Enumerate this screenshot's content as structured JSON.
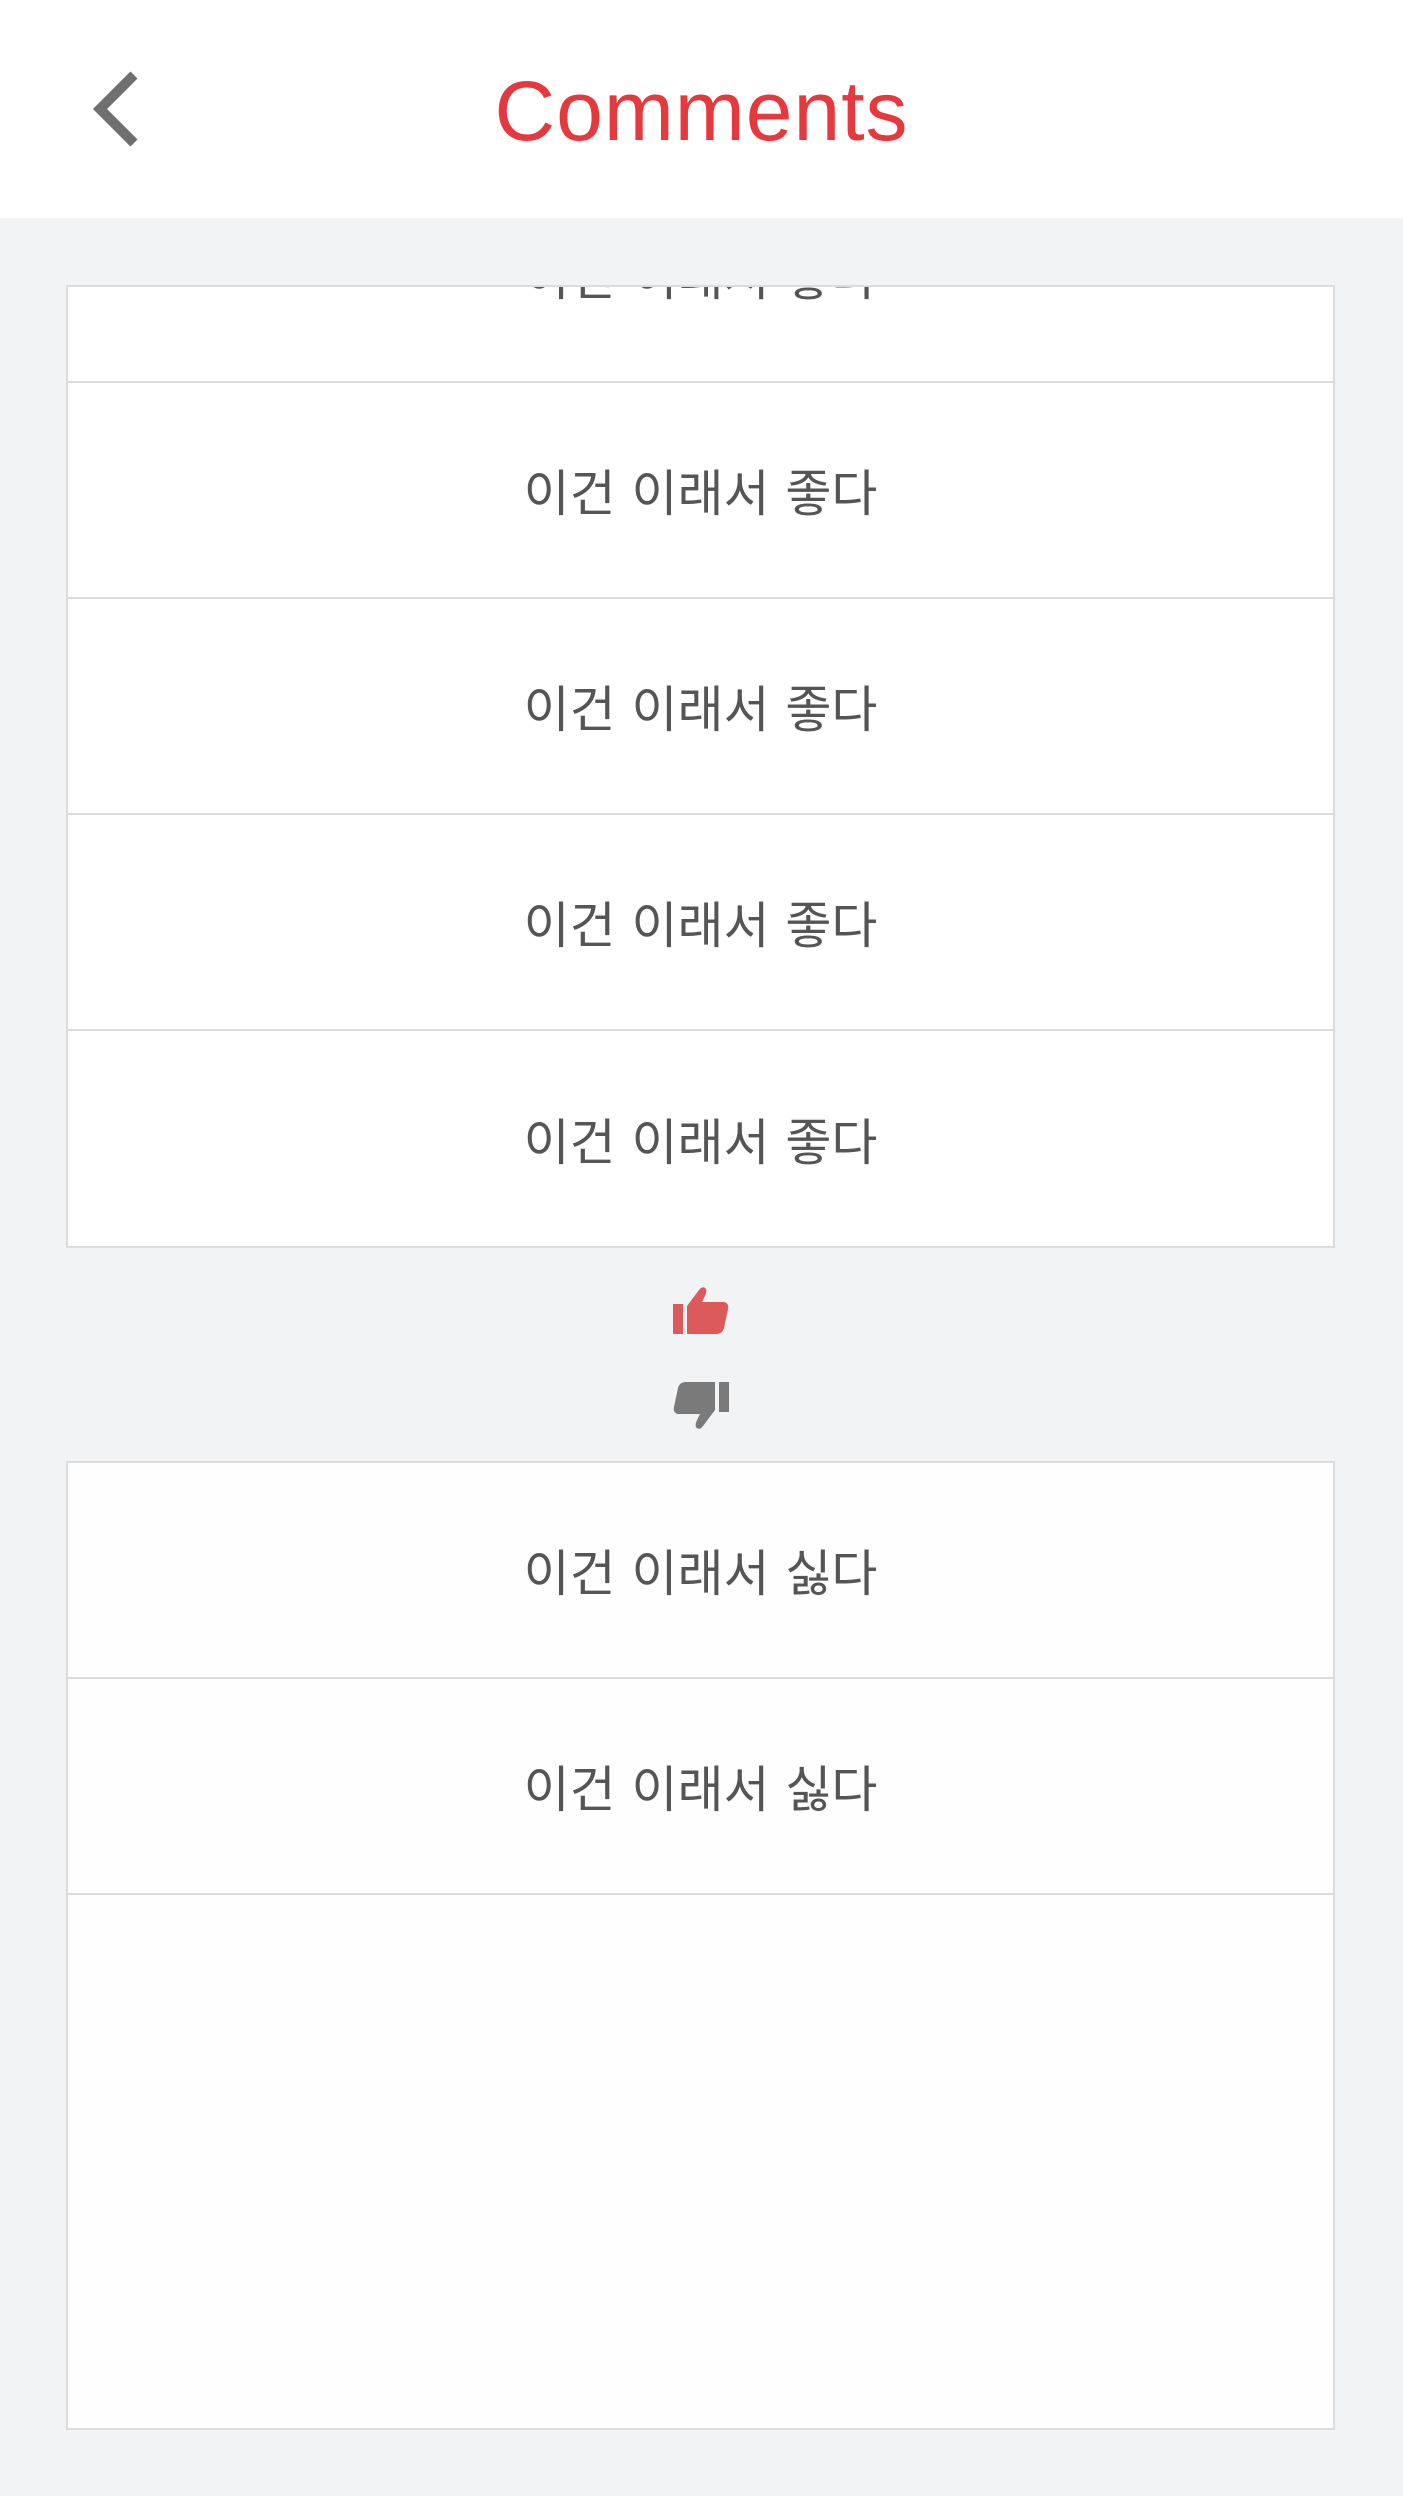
{
  "header": {
    "title": "Comments",
    "back_icon": "chevron-left-icon"
  },
  "colors": {
    "accent": "#e5393e",
    "like": "#dc5a5a",
    "dislike": "#7a7a7a",
    "icon_gray": "#6f6f6f",
    "text": "#555555",
    "background": "#f2f3f5",
    "border": "#dcdcdc"
  },
  "likes": {
    "icon": "thumbs-up-icon",
    "items": [
      {
        "text": "이건 이래서 좋다"
      },
      {
        "text": "이건 이래서 좋다"
      },
      {
        "text": "이건 이래서 좋다"
      },
      {
        "text": "이건 이래서 좋다"
      },
      {
        "text": "이건 이래서 좋다"
      }
    ]
  },
  "dislikes": {
    "icon": "thumbs-down-icon",
    "items": [
      {
        "text": "이건 이래서 싫다"
      },
      {
        "text": "이건 이래서 싫다"
      }
    ]
  }
}
